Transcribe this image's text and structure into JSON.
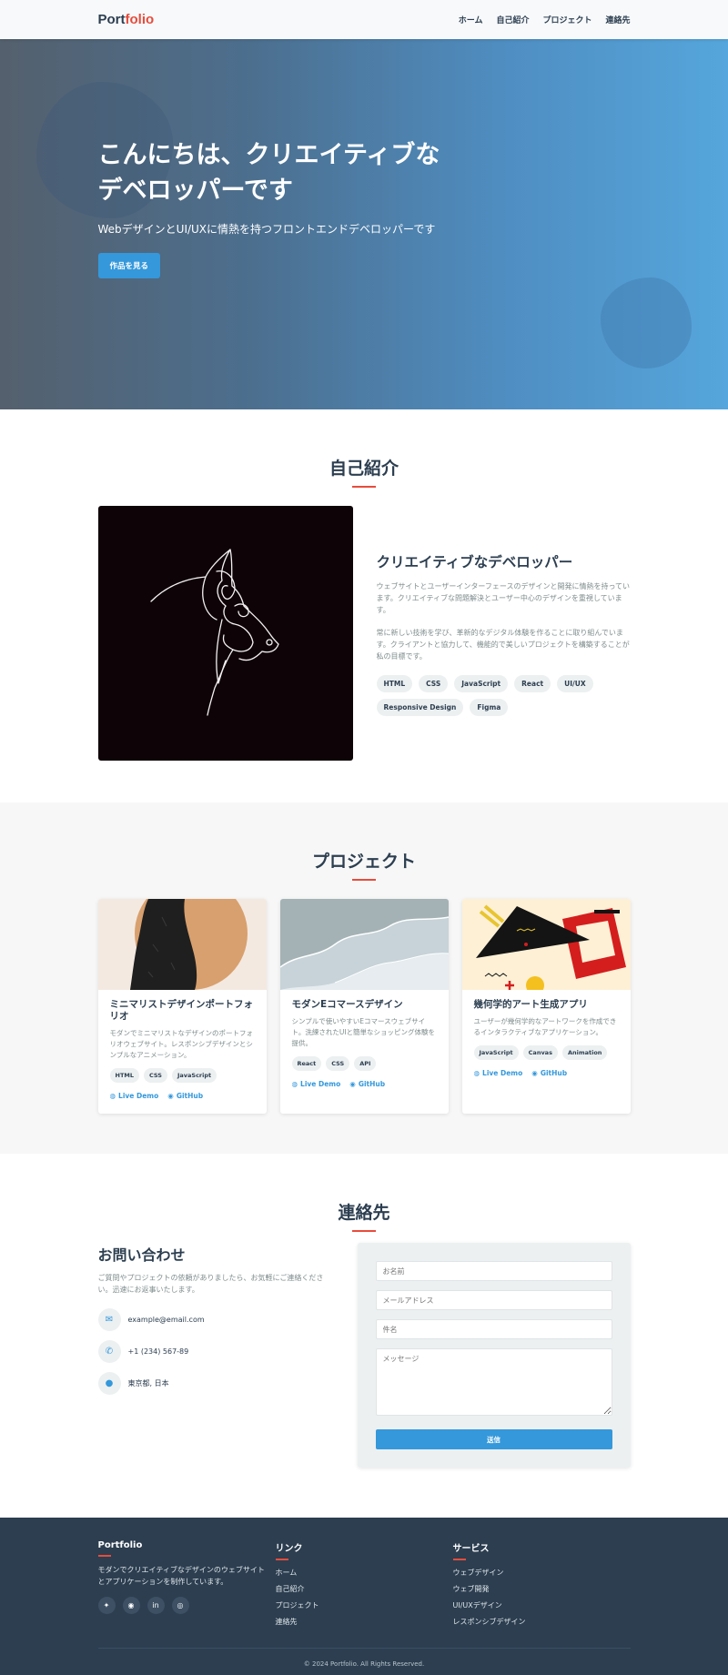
{
  "nav": {
    "logo_main": "Port",
    "logo_accent": "folio",
    "links": [
      "ホーム",
      "自己紹介",
      "プロジェクト",
      "連絡先"
    ]
  },
  "hero": {
    "title_line1": "こんにちは、クリエイティブな",
    "title_line2": "デベロッパーです",
    "subtitle": "WebデザインとUI/UXに情熱を持つフロントエンドデベロッパーです",
    "button": "作品を見る"
  },
  "about": {
    "title": "自己紹介",
    "heading": "クリエイティブなデベロッパー",
    "para1": "ウェブサイトとユーザーインターフェースのデザインと開発に情熱を持っています。クリエイティブな問題解決とユーザー中心のデザインを重視しています。",
    "para2": "常に新しい技術を学び、革新的なデジタル体験を作ることに取り組んでいます。クライアントと協力して、機能的で美しいプロジェクトを構築することが私の目標です。",
    "skills": [
      "HTML",
      "CSS",
      "JavaScript",
      "React",
      "UI/UX",
      "Responsive Design",
      "Figma"
    ]
  },
  "projects": {
    "title": "プロジェクト",
    "live_label": "Live Demo",
    "github_label": "GitHub",
    "items": [
      {
        "title": "ミニマリストデザインポートフォリオ",
        "desc": "モダンでミニマリストなデザインのポートフォリオウェブサイト。レスポンシブデザインとシンプルなアニメーション。",
        "tags": [
          "HTML",
          "CSS",
          "JavaScript"
        ]
      },
      {
        "title": "モダンEコマースデザイン",
        "desc": "シンプルで使いやすいEコマースウェブサイト。洗練されたUIと簡単なショッピング体験を提供。",
        "tags": [
          "React",
          "CSS",
          "API"
        ]
      },
      {
        "title": "幾何学的アート生成アプリ",
        "desc": "ユーザーが幾何学的なアートワークを作成できるインタラクティブなアプリケーション。",
        "tags": [
          "JavaScript",
          "Canvas",
          "Animation"
        ]
      }
    ]
  },
  "contact": {
    "title": "連絡先",
    "heading": "お問い合わせ",
    "text": "ご質問やプロジェクトの依頼がありましたら、お気軽にご連絡ください。迅速にお返事いたします。",
    "email": "example@email.com",
    "phone": "+1 (234) 567-89",
    "address": "東京都, 日本",
    "form": {
      "name_placeholder": "お名前",
      "email_placeholder": "メールアドレス",
      "subject_placeholder": "件名",
      "message_placeholder": "メッセージ",
      "submit": "送信"
    }
  },
  "footer": {
    "brand": "Portfolio",
    "brand_text": "モダンでクリエイティブなデザインのウェブサイトとアプリケーションを制作しています。",
    "links_title": "リンク",
    "links": [
      "ホーム",
      "自己紹介",
      "プロジェクト",
      "連絡先"
    ],
    "services_title": "サービス",
    "services": [
      "ウェブデザイン",
      "ウェブ開発",
      "UI/UXデザイン",
      "レスポンシブデザイン"
    ],
    "copyright": "© 2024 Portfolio. All Rights Reserved.",
    "socials": [
      "twitter-icon",
      "github-icon",
      "linkedin-icon",
      "instagram-icon"
    ]
  },
  "colors": {
    "primary": "#3498db",
    "accent": "#e74c3c",
    "dark": "#2c3e50"
  }
}
